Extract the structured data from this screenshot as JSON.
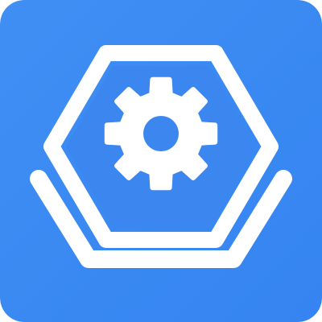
{
  "app_icon": {
    "icon": "settings-gear-hexagon-icon",
    "colors": {
      "background": "#3f8ff4",
      "foreground": "#ffffff",
      "inner": "#3b86ef"
    }
  }
}
